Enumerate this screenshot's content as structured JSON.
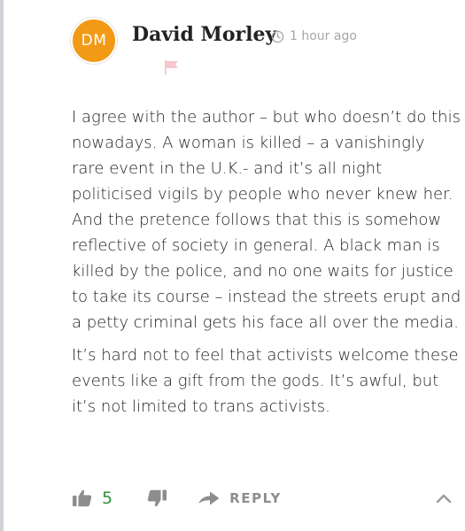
{
  "comment": {
    "avatar_initials": "DM",
    "author": "David Morley",
    "time": "1 hour ago",
    "paragraphs": [
      "I agree with the author – but who doesn’t do this nowadays. A woman is killed – a vanishingly rare event in the U.K.- and it’s all night politicised vigils by people who never knew her. And the pretence follows that this is somehow reflective of society in general. A black man is killed by the police, and no one waits for justice to take its course – instead the streets erupt and a petty criminal gets his face all over the media.",
      "It’s hard not to feel that activists welcome these events like a gift from the gods. It’s awful, but it’s not limited to trans activists."
    ],
    "upvote_count": "5",
    "reply_label": "REPLY"
  },
  "colors": {
    "avatar_bg": "#f29a16",
    "upvote_green": "#2f8f3b",
    "flag_pink": "#f7c7cf",
    "muted_gray": "#8d8d8d",
    "thread_line": "#cfd2d6"
  },
  "icons": {
    "time": "clock-icon",
    "report": "flag-icon",
    "upvote": "thumbs-up-icon",
    "downvote": "thumbs-down-icon",
    "reply": "reply-arrow-icon",
    "collapse": "chevron-up-icon"
  }
}
